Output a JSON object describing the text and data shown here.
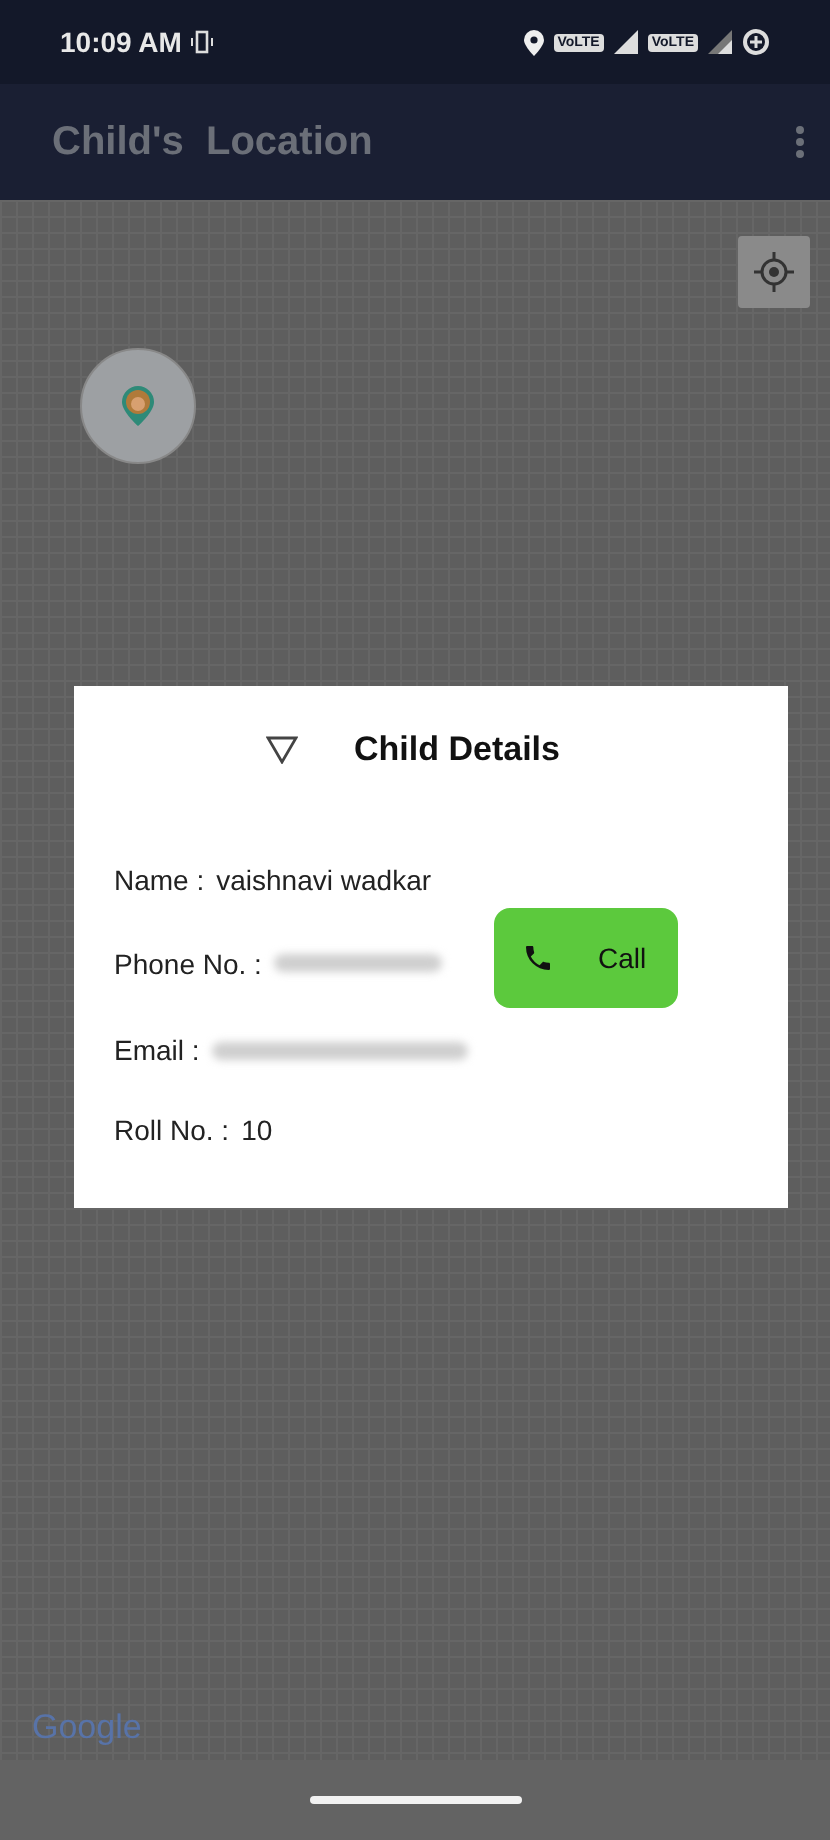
{
  "status_bar": {
    "time": "10:09 AM",
    "badges": [
      "VoLTE",
      "VoLTE"
    ]
  },
  "app_bar": {
    "title": "Child's  Location"
  },
  "map": {
    "attribution": "Google"
  },
  "dialog": {
    "title": "Child Details",
    "fields": [
      {
        "kind": "text",
        "label": "Name :",
        "value": "vaishnavi wadkar"
      },
      {
        "kind": "blurred",
        "label": "Phone No.  :"
      },
      {
        "kind": "blurred",
        "label": "Email  :"
      },
      {
        "kind": "text",
        "label": "Roll No. :",
        "value": "10"
      }
    ],
    "call_button": "Call"
  }
}
